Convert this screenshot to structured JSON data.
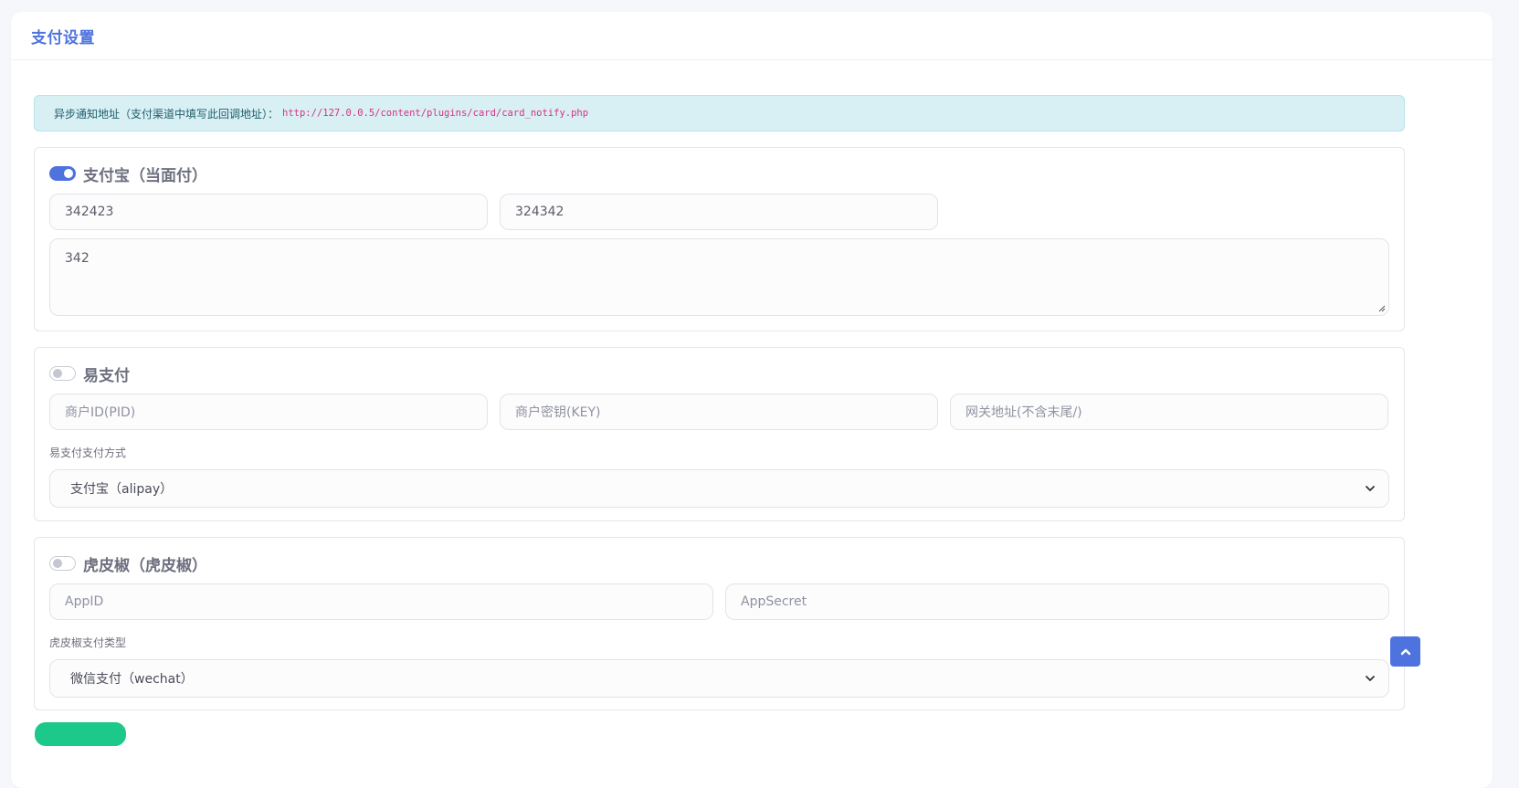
{
  "card": {
    "title": "支付设置"
  },
  "notify": {
    "label": "异步通知地址（支付渠道中填写此回调地址）：",
    "url": "http://127.0.0.5/content/plugins/card/card_notify.php"
  },
  "alipay": {
    "title": "支付宝（当面付）",
    "enabled": true,
    "field1_value": "342423",
    "field2_value": "324342",
    "textarea_value": "342"
  },
  "epay": {
    "title": "易支付",
    "enabled": false,
    "pid_placeholder": "商户ID(PID)",
    "key_placeholder": "商户密钥(KEY)",
    "gateway_placeholder": "网关地址(不含末尾/)",
    "method_label": "易支付支付方式",
    "method_value": "支付宝（alipay）"
  },
  "xunhu": {
    "title": "虎皮椒（虎皮椒）",
    "enabled": false,
    "appid_placeholder": "AppID",
    "appsecret_placeholder": "AppSecret",
    "type_label": "虎皮椒支付类型",
    "type_value": "微信支付（wechat）"
  },
  "colors": {
    "primary": "#4e73df",
    "info_bg": "#d8eff4",
    "success": "#1cc88a"
  },
  "icons": {
    "toggle_on": "switch-on-icon",
    "toggle_off": "switch-off-icon",
    "chevron": "chevron-down-icon",
    "back_to_top": "chevron-up-icon"
  }
}
